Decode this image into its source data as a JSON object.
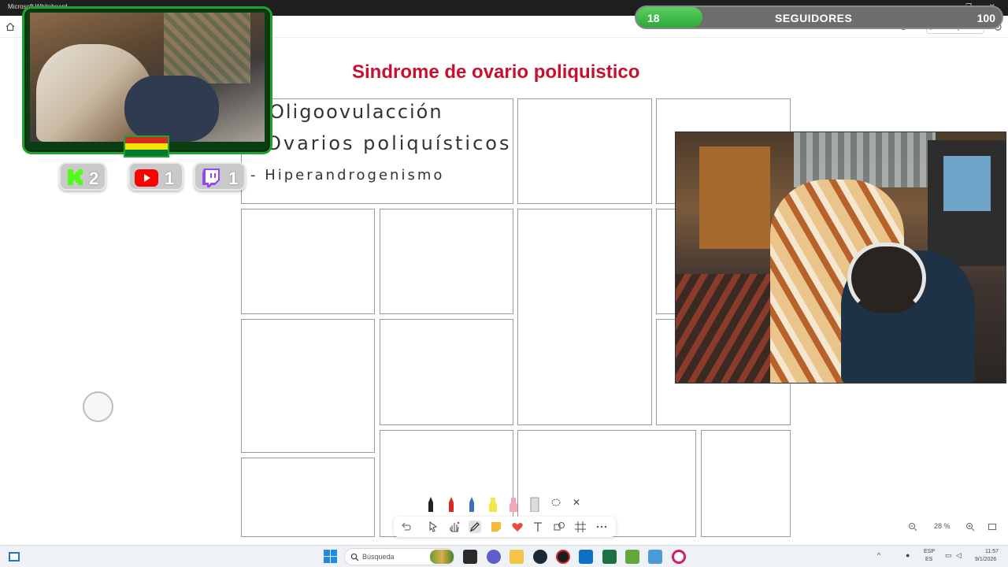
{
  "window": {
    "app_title": "Microsoft Whiteboard",
    "minimize": "—",
    "restore": "❐",
    "close": "✕"
  },
  "toolbar": {
    "share_label": "Compartir"
  },
  "followers": {
    "current": "18",
    "label": "SEGUIDORES",
    "goal": "100",
    "progress_fraction": 0.18,
    "fill_color": "#3fba4a"
  },
  "board": {
    "title": "Sindrome de ovario poliquistico",
    "title_color": "#c8102e",
    "notes": [
      "Oligoovulacción",
      "Ovarios poliquísticos",
      "- Hiperandrogenismo"
    ]
  },
  "stream_badges": {
    "kick": {
      "icon": "kick-icon",
      "count": "2",
      "color": "#53fc18"
    },
    "youtube": {
      "icon": "youtube-icon",
      "count": "1",
      "color": "#ff0000"
    },
    "twitch": {
      "icon": "twitch-icon",
      "count": "1",
      "color": "#9146ff"
    }
  },
  "flag": {
    "icon": "bolivia-flag-icon"
  },
  "pens": [
    "black-pen",
    "red-pen",
    "blue-pen",
    "yellow-highlighter",
    "pink-highlighter",
    "ruler-icon",
    "lasso-icon"
  ],
  "pen_toolbar_close": "✕",
  "tools": [
    "undo-icon",
    "select-icon",
    "hand-icon",
    "pen-icon",
    "sticky-note-icon",
    "reaction-icon",
    "text-icon",
    "shapes-icon",
    "frame-icon",
    "more-icon"
  ],
  "zoom": {
    "value": "28 %"
  },
  "taskbar": {
    "search_placeholder": "Búsqueda",
    "lang_top": "ESP",
    "lang_bottom": "ES",
    "time": "11:57",
    "date": "9/1/2026"
  }
}
